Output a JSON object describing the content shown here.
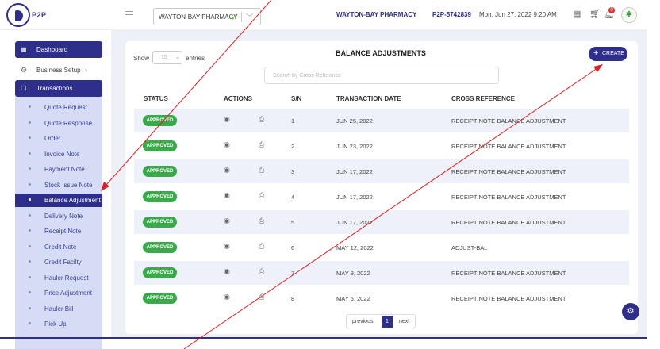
{
  "header": {
    "logo_text": "P2P",
    "org_select_value": "WAYTON-BAY PHARMACY",
    "org_name": "WAYTON-BAY PHARMACY",
    "org_code": "P2P-5742839",
    "datetime": "Mon, Jun 27, 2022 9:20 AM",
    "notification_count": "0",
    "icons": [
      "menu-icon",
      "checkmark-icon",
      "chevron-down-icon",
      "list-icon",
      "cart-icon",
      "bell-icon",
      "avatar-icon"
    ]
  },
  "sidebar": {
    "dashboard": "Dashboard",
    "business_setup": "Business Setup",
    "transactions": "Transactions",
    "items": [
      "Quote Request",
      "Quote Response",
      "Order",
      "Invoice Note",
      "Payment Note",
      "Stock Issue Note",
      "Balance Adjustment",
      "Delivery Note",
      "Receipt Note",
      "Credit Note",
      "Credit Facilty",
      "Hauler Request",
      "Price Adjustment",
      "Hauler Bill",
      "Pick Up"
    ],
    "active_item": "Balance Adjustment"
  },
  "main": {
    "title": "BALANCE ADJUSTMENTS",
    "show_label": "Show",
    "page_length": "15",
    "entries_label": "entries",
    "search_placeholder": "Search by Cross Reference",
    "create_label": "CREATE",
    "columns": [
      "STATUS",
      "ACTIONS",
      "S/N",
      "TRANSACTION DATE",
      "CROSS REFERENCE"
    ],
    "rows": [
      {
        "status": "APPROVED",
        "sn": "1",
        "date": "JUN 25, 2022",
        "ref": "RECEIPT NOTE BALANCE ADJUSTMENT"
      },
      {
        "status": "APPROVED",
        "sn": "2",
        "date": "JUN 23, 2022",
        "ref": "RECEIPT NOTE BALANCE ADJUSTMENT"
      },
      {
        "status": "APPROVED",
        "sn": "3",
        "date": "JUN 17, 2022",
        "ref": "RECEIPT NOTE BALANCE ADJUSTMENT"
      },
      {
        "status": "APPROVED",
        "sn": "4",
        "date": "JUN 17, 2022",
        "ref": "RECEIPT NOTE BALANCE ADJUSTMENT"
      },
      {
        "status": "APPROVED",
        "sn": "5",
        "date": "JUN 17, 2022",
        "ref": "RECEIPT NOTE BALANCE ADJUSTMENT"
      },
      {
        "status": "APPROVED",
        "sn": "6",
        "date": "MAY 12, 2022",
        "ref": "ADJUST-BAL"
      },
      {
        "status": "APPROVED",
        "sn": "7",
        "date": "MAY 9, 2022",
        "ref": "RECEIPT NOTE BALANCE ADJUSTMENT"
      },
      {
        "status": "APPROVED",
        "sn": "8",
        "date": "MAY 6, 2022",
        "ref": "RECEIPT NOTE BALANCE ADJUSTMENT"
      }
    ],
    "pager": {
      "prev": "previous",
      "current": "1",
      "next": "next"
    }
  },
  "colors": {
    "brand": "#2e2f8a",
    "approved": "#3aa94a",
    "sidebar_panel": "#d6dcf6",
    "annotation_line": "#e02020"
  }
}
